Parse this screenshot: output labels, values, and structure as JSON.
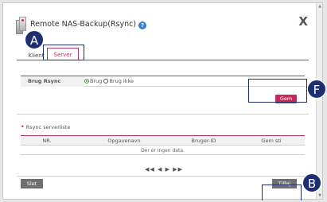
{
  "dialog": {
    "title": "Remote NAS-Backup(Rsync)",
    "help_glyph": "?",
    "close_glyph": "X"
  },
  "tabs": [
    {
      "label": "Klient"
    },
    {
      "label": "Server"
    }
  ],
  "settings": {
    "brug_rsync_label": "Brug Rsync",
    "options": [
      {
        "label": "Brug",
        "selected": true
      },
      {
        "label": "Brug ikke",
        "selected": false
      }
    ],
    "save_label": "Gem"
  },
  "server_list": {
    "title": "Rsync serverliste",
    "columns": [
      "NR.",
      "Opgavenavn",
      "Bruger-ID",
      "Gem sti"
    ],
    "empty_message": "Der er ingen data.",
    "pager": "◀◀ ◀ ▶ ▶▶"
  },
  "footer": {
    "delete_label": "Slet",
    "add_label": "Tilføj"
  },
  "annotations": [
    {
      "letter": "A"
    },
    {
      "letter": "F"
    },
    {
      "letter": "B"
    }
  ],
  "colors": {
    "accent": "#c12b55",
    "annotation": "#1d2f70",
    "button_gray": "#6f6f6f"
  }
}
